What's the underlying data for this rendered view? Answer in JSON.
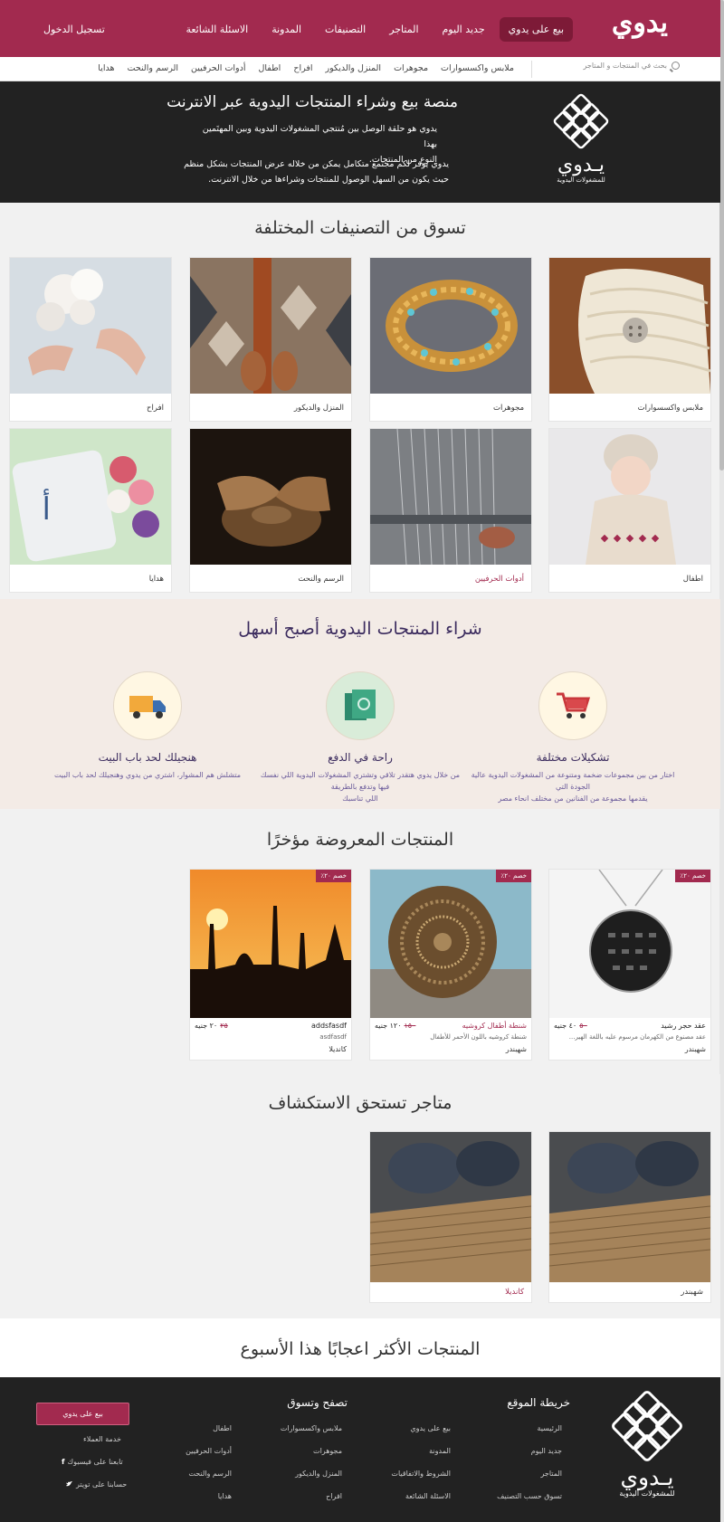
{
  "header": {
    "logo": "يدوي",
    "nav": [
      "بيع على يدوي",
      "جديد اليوم",
      "المتاجر",
      "التصنيفات",
      "المدونة",
      "الاسئلة الشائعة"
    ],
    "login": "تسجيل الدخول"
  },
  "subnav": {
    "search_placeholder": "بحث في المنتجات و المتاجر",
    "categories": [
      "ملابس واكسسوارات",
      "مجوهرات",
      "المنزل والديكور",
      "افراح",
      "اطفال",
      "أدوات الحرفيين",
      "الرسم والنحت",
      "هدايا"
    ]
  },
  "hero": {
    "logo_name": "يـدوي",
    "logo_sub": "للمشغولات اليدوية",
    "title": "منصة بيع وشراء المنتجات اليدوية عبر الانترنت",
    "p1_line1": "يدوي هو حلقة الوصل بين مُنتجي المشغولات اليدوية وبين المهتَمين بهذا",
    "p1_line2": "النوع من المنتجات.",
    "p2_line1": "يدوي يوفر لكم مجتمع متكامل يمكن من خلاله عرض المنتجات بشكل منظم",
    "p2_line2": "حيث يكون من السهل الوصول للمنتجات وشراءها من خلال الانترنت."
  },
  "categories_section": {
    "title": "تسوق من التصنيفات المختلفة",
    "items": [
      "ملابس واكسسوارات",
      "مجوهرات",
      "المنزل والديكور",
      "افراح",
      "اطفال",
      "أدوات الحرفيين",
      "الرسم والنحت",
      "هدايا"
    ]
  },
  "benefits": {
    "title": "شراء المنتجات اليدوية أصبح أسهل",
    "items": [
      {
        "title": "تشكيلات مختلفة",
        "line1": "اختار من بين مجموعات ضخمة ومتنوعة من المشغولات اليدوية عالية الجودة التي",
        "line2": "يقدمها مجموعة من الفنانين من مختلف انحاء مصر",
        "icon": "cart-icon"
      },
      {
        "title": "راحة في الدفع",
        "line1": "من خلال يدوي هتقدر تلاقي وتشتري المشغولات اليدوية اللي نفسك فيها وتدفع بالطريقة",
        "line2": "اللي تناسبك",
        "icon": "money-icon"
      },
      {
        "title": "هنجيلك لحد باب البيت",
        "line1": "متشلش هم المشوار، اشتري من يدوي وهنجيلك لحد باب البيت",
        "line2": "",
        "icon": "truck-icon"
      }
    ]
  },
  "products": {
    "title": "المنتجات المعروضة مؤخرًا",
    "items": [
      {
        "discount": "خصم ٢٠٪",
        "name": "عقد حجر رشيد",
        "old_price": "٥٠",
        "price": "٤٠ جنيه",
        "desc": "عقد مصنوع من الكهرمان مرسوم عليه باللغة الهير...",
        "store": "شهبندر"
      },
      {
        "discount": "خصم ٢٠٪",
        "name": "شنطة أطفال كروشيه",
        "old_price": "١٥٠",
        "price": "١٢٠ جنيه",
        "desc": "شنطة كروشيه باللون الأحمر للأطفال",
        "store": "شهبندر"
      },
      {
        "discount": "خصم ٢٠٪",
        "name": "addsfasdf",
        "old_price": "٢٥",
        "price": "٢٠ جنيه",
        "desc": "asdfasdf",
        "store": "كانديلا"
      }
    ]
  },
  "stores": {
    "title": "متاجر تستحق الاستكشاف",
    "items": [
      "شهبندر",
      "كانديلا"
    ]
  },
  "weekly": {
    "title": "المنتجات الأكثر اعجابًا هذا الأسبوع"
  },
  "footer": {
    "logo_name": "يـدوي",
    "logo_sub": "للمشغولات اليدوية",
    "sitemap_title": "خريطة الموقع",
    "browse_title": "تصفح وتسوق",
    "col1": [
      "الرئيسية",
      "جديد اليوم",
      "المتاجر",
      "تسوق حسب التصنيف"
    ],
    "col2": [
      "بيع على يدوي",
      "المدونة",
      "الشروط والاتفاقيات",
      "الاسئلة الشائعة"
    ],
    "col3": [
      "ملابس واكسسوارات",
      "مجوهرات",
      "المنزل والديكور",
      "افراح"
    ],
    "col4": [
      "اطفال",
      "أدوات الحرفيين",
      "الرسم والنحت",
      "هدايا"
    ],
    "sell_button": "بيع على يدوي",
    "customer_service": "خدمة العملاء",
    "facebook": "تابعنا على فيسبوك",
    "twitter": "حسابنا على تويتر"
  },
  "colors": {
    "brand": "#a22a4f",
    "dark": "#222222",
    "benefit_bg": "#f3ebe6"
  }
}
